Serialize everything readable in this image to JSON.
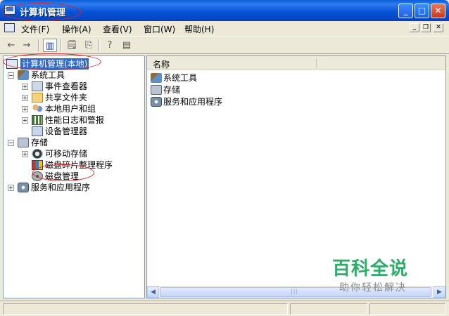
{
  "window": {
    "title": "计算机管理",
    "controls": {
      "minimize": "_",
      "maximize": "□",
      "close": "✕"
    }
  },
  "menubar": {
    "items": [
      "文件(F)",
      "操作(A)",
      "查看(V)",
      "窗口(W)",
      "帮助(H)"
    ],
    "mdi_controls": [
      "_",
      "❐",
      "✕"
    ]
  },
  "toolbar": {
    "buttons": [
      {
        "icon": "back-arrow-icon",
        "glyph": "←"
      },
      {
        "icon": "forward-arrow-icon",
        "glyph": "→"
      },
      {
        "icon": "show-hide-tree-icon",
        "glyph": "▥"
      },
      {
        "icon": "properties-icon",
        "glyph": "🗒"
      },
      {
        "icon": "export-list-icon",
        "glyph": "⎘"
      },
      {
        "icon": "help-icon",
        "glyph": "?"
      },
      {
        "icon": "action-pane-icon",
        "glyph": "▤"
      }
    ]
  },
  "tree": {
    "root": "计算机管理(本地)",
    "system_tools": {
      "label": "系统工具",
      "children": [
        "事件查看器",
        "共享文件夹",
        "本地用户和组",
        "性能日志和警报",
        "设备管理器"
      ]
    },
    "storage": {
      "label": "存储",
      "children": [
        "可移动存储",
        "磁盘碎片整理程序",
        "磁盘管理"
      ]
    },
    "services": {
      "label": "服务和应用程序"
    }
  },
  "list": {
    "column": "名称",
    "items": [
      "系统工具",
      "存储",
      "服务和应用程序"
    ]
  },
  "scrollbar": {
    "left": "◀",
    "right": "▶"
  },
  "watermark": {
    "title": "百科全说",
    "subtitle": "助你轻松解决"
  },
  "colors": {
    "titlebar": "#0753d6",
    "selection": "#316ac5",
    "annotation": "#d8232a",
    "watermark": "#2eac68"
  }
}
